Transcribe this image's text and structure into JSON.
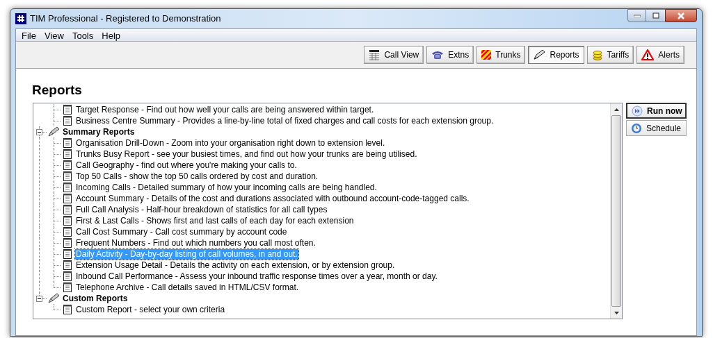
{
  "window": {
    "title": "TIM Professional - Registered to Demonstration"
  },
  "menu": [
    "File",
    "View",
    "Tools",
    "Help"
  ],
  "toolbar": [
    {
      "label": "Call View",
      "kind": "grid",
      "selected": false
    },
    {
      "label": "Extns",
      "kind": "phone",
      "selected": false
    },
    {
      "label": "Trunks",
      "kind": "stripes",
      "selected": false
    },
    {
      "label": "Reports",
      "kind": "pen",
      "selected": true
    },
    {
      "label": "Tariffs",
      "kind": "coins",
      "selected": false
    },
    {
      "label": "Alerts",
      "kind": "warning",
      "selected": false
    }
  ],
  "heading": "Reports",
  "tree": [
    {
      "kind": "leaf",
      "label": "Target Response - Find out how well your calls are being answered within target.",
      "selected": false
    },
    {
      "kind": "leaf",
      "label": "Business Centre Summary - Provides a line-by-line total of fixed charges and call costs for each extension group.",
      "selected": false
    },
    {
      "kind": "group",
      "label": "Summary Reports",
      "expanded": true,
      "children": [
        {
          "label": "Organisation Drill-Down - Zoom into your organisation right down to extension level.",
          "selected": false
        },
        {
          "label": "Trunks Busy Report - see your busiest times, and find out how your trunks are being utilised.",
          "selected": false
        },
        {
          "label": "Call Geography - find out where you're making your calls to.",
          "selected": false
        },
        {
          "label": "Top 50 Calls - show the top 50 calls ordered by cost and duration.",
          "selected": false
        },
        {
          "label": "Incoming Calls - Detailed summary of how your incoming calls are being handled.",
          "selected": false
        },
        {
          "label": "Account Summary - Details of the cost and durations associated with outbound account-code-tagged calls.",
          "selected": false
        },
        {
          "label": "Full Call Analysis - Half-hour breakdown of statistics for all call types",
          "selected": false
        },
        {
          "label": "First & Last Calls - Shows first and last calls of each day for each extension",
          "selected": false
        },
        {
          "label": "Call Cost Summary - Call cost summary by account code",
          "selected": false
        },
        {
          "label": "Frequent Numbers - Find out which numbers you call most often.",
          "selected": false
        },
        {
          "label": "Daily Activity - Day-by-day listing of call volumes, in and out.",
          "selected": true
        },
        {
          "label": "Extension Usage Detail - Details the activity on each extension, or by extension group.",
          "selected": false
        },
        {
          "label": "Inbound Call Performance - Assess your inbound traffic response times over a year, month or day.",
          "selected": false
        },
        {
          "label": "Telephone Archive - Call details saved in HTML/CSV format.",
          "selected": false
        }
      ]
    },
    {
      "kind": "group",
      "label": "Custom Reports",
      "expanded": true,
      "children": [
        {
          "label": "Custom Report - select your own criteria",
          "selected": false
        }
      ]
    }
  ],
  "actions": [
    {
      "label": "Run now",
      "kind": "run",
      "default": true
    },
    {
      "label": "Schedule",
      "kind": "clock",
      "default": false
    }
  ]
}
